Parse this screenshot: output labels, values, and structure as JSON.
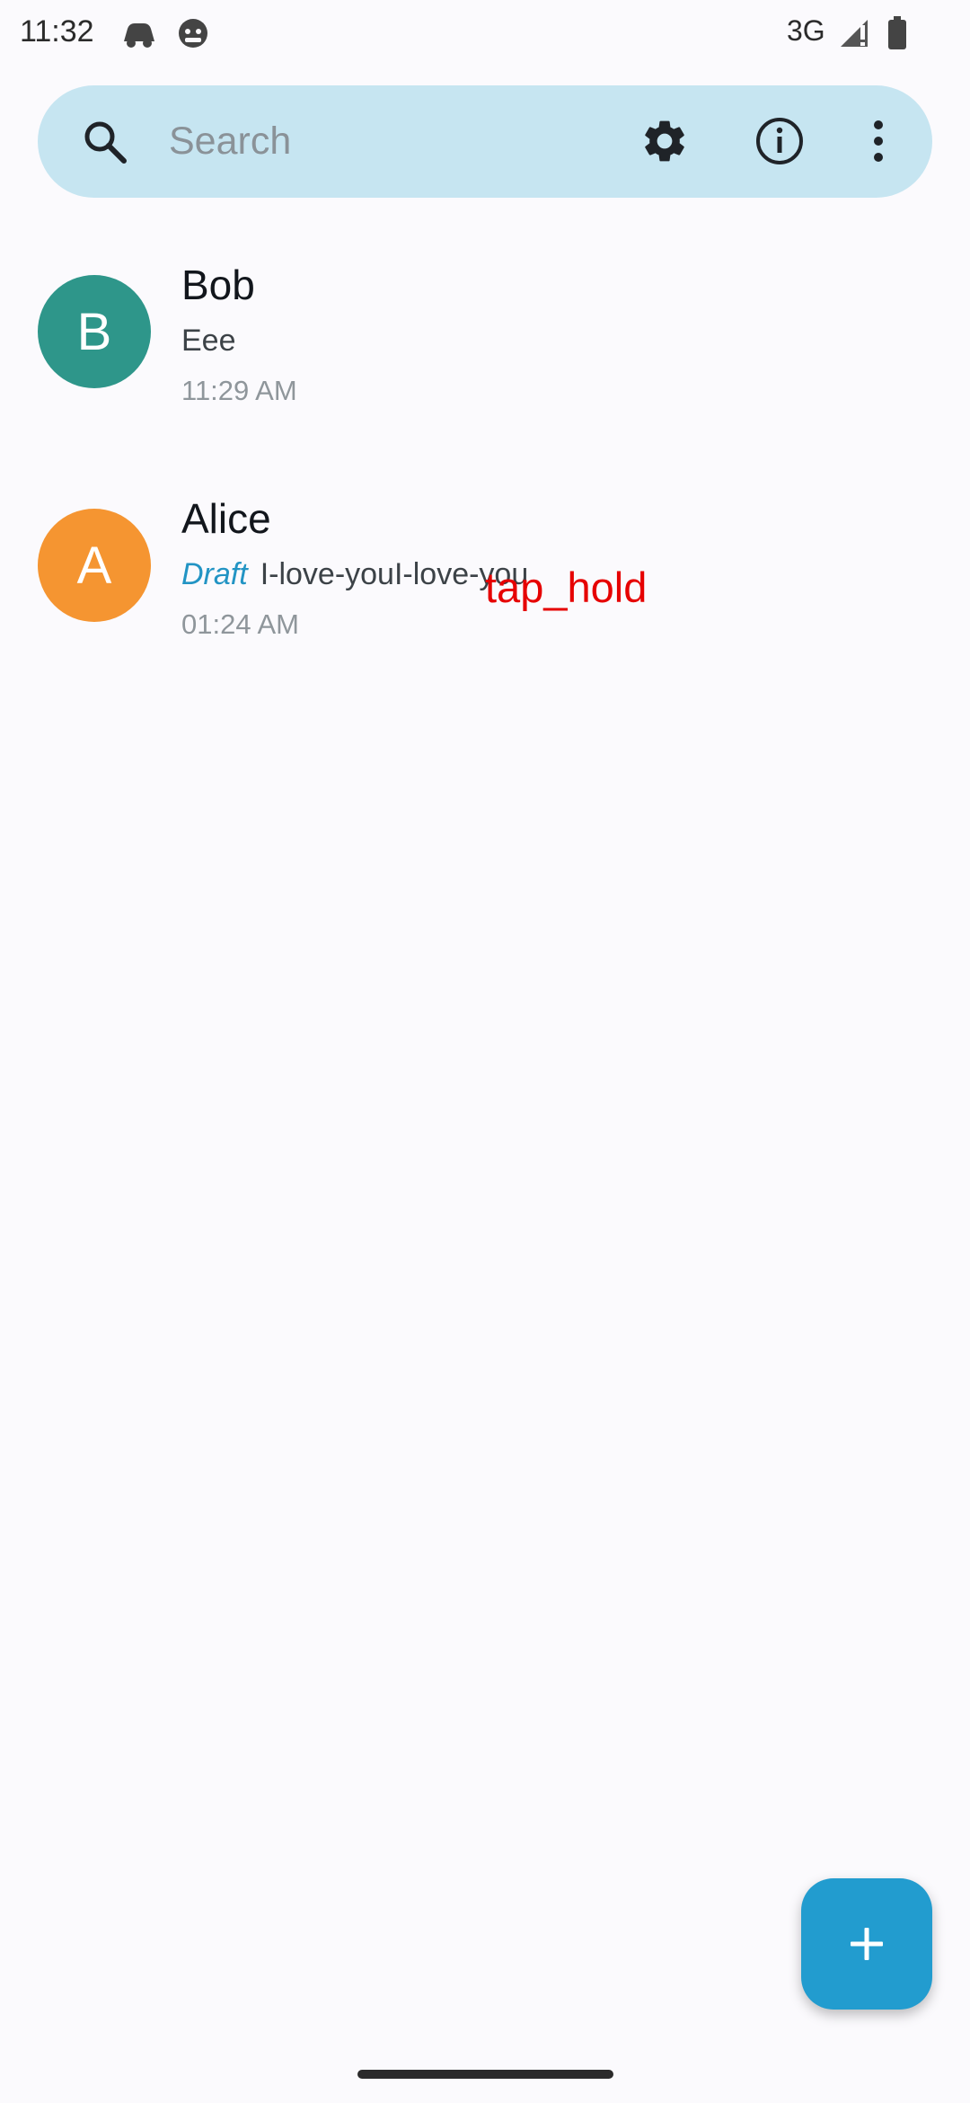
{
  "status_bar": {
    "time": "11:32",
    "network": "3G",
    "icons": [
      "notification-app-icon",
      "notification-android-icon",
      "signal-icon",
      "battery-icon"
    ]
  },
  "search": {
    "placeholder": "Search",
    "value": "",
    "icons": [
      "search-icon",
      "settings-icon",
      "info-icon",
      "more-options-icon"
    ]
  },
  "chats": [
    {
      "avatar_letter": "B",
      "avatar_color": "#2e968a",
      "name": "Bob",
      "message": "Eee",
      "draft_label": "",
      "time": "11:29 AM"
    },
    {
      "avatar_letter": "A",
      "avatar_color": "#f59531",
      "name": "Alice",
      "draft_label": "Draft",
      "message": "I-love-youI-love-you",
      "time": "01:24 AM"
    }
  ],
  "annotation": {
    "text": "tap_hold"
  },
  "fab": {
    "icon": "plus-icon",
    "color": "#229ccf"
  },
  "colors": {
    "search_bar_bg": "#c6e5f1",
    "background": "#fbfafd",
    "draft_accent": "#2294c4",
    "annotation": "#e60000"
  }
}
